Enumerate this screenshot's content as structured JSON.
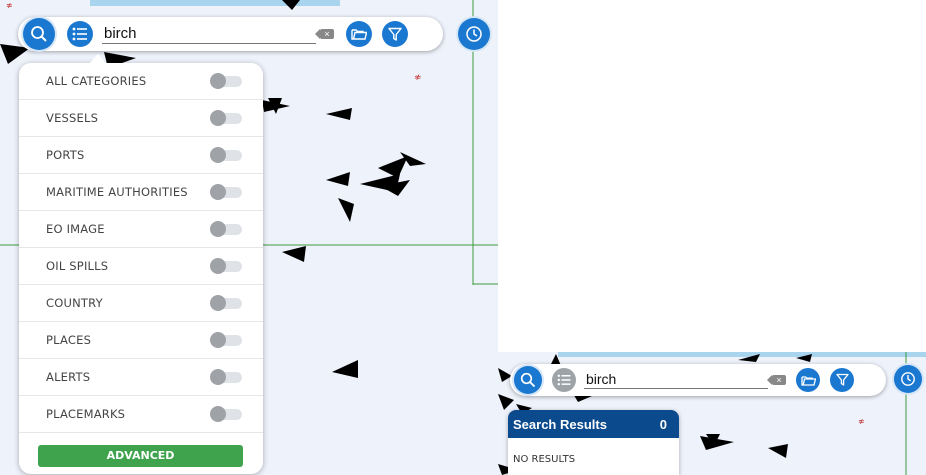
{
  "panel_main": {
    "search": {
      "value": "birch"
    },
    "categories": [
      {
        "label": "ALL CATEGORIES"
      },
      {
        "label": "VESSELS"
      },
      {
        "label": "PORTS"
      },
      {
        "label": "MARITIME AUTHORITIES"
      },
      {
        "label": "EO IMAGE"
      },
      {
        "label": "OIL SPILLS"
      },
      {
        "label": "COUNTRY"
      },
      {
        "label": "PLACES"
      },
      {
        "label": "ALERTS"
      },
      {
        "label": "PLACEMARKS"
      }
    ],
    "advanced_label": "ADVANCED"
  },
  "panel_results": {
    "search": {
      "value": "birch"
    },
    "results_title": "Search Results",
    "results_count": "0",
    "no_results": "NO RESULTS"
  },
  "colors": {
    "map_water": "#eef2fb",
    "accent_blue": "#1b78d0",
    "results_header": "#0b4a8d",
    "advanced_green": "#3fa34d",
    "toggle_off": "#9fa3a7"
  },
  "icons": [
    "search-icon",
    "list-icon",
    "backspace-icon",
    "folder-icon",
    "filter-icon",
    "clock-icon",
    "vessel-marker-icon",
    "place-marker-icon"
  ]
}
